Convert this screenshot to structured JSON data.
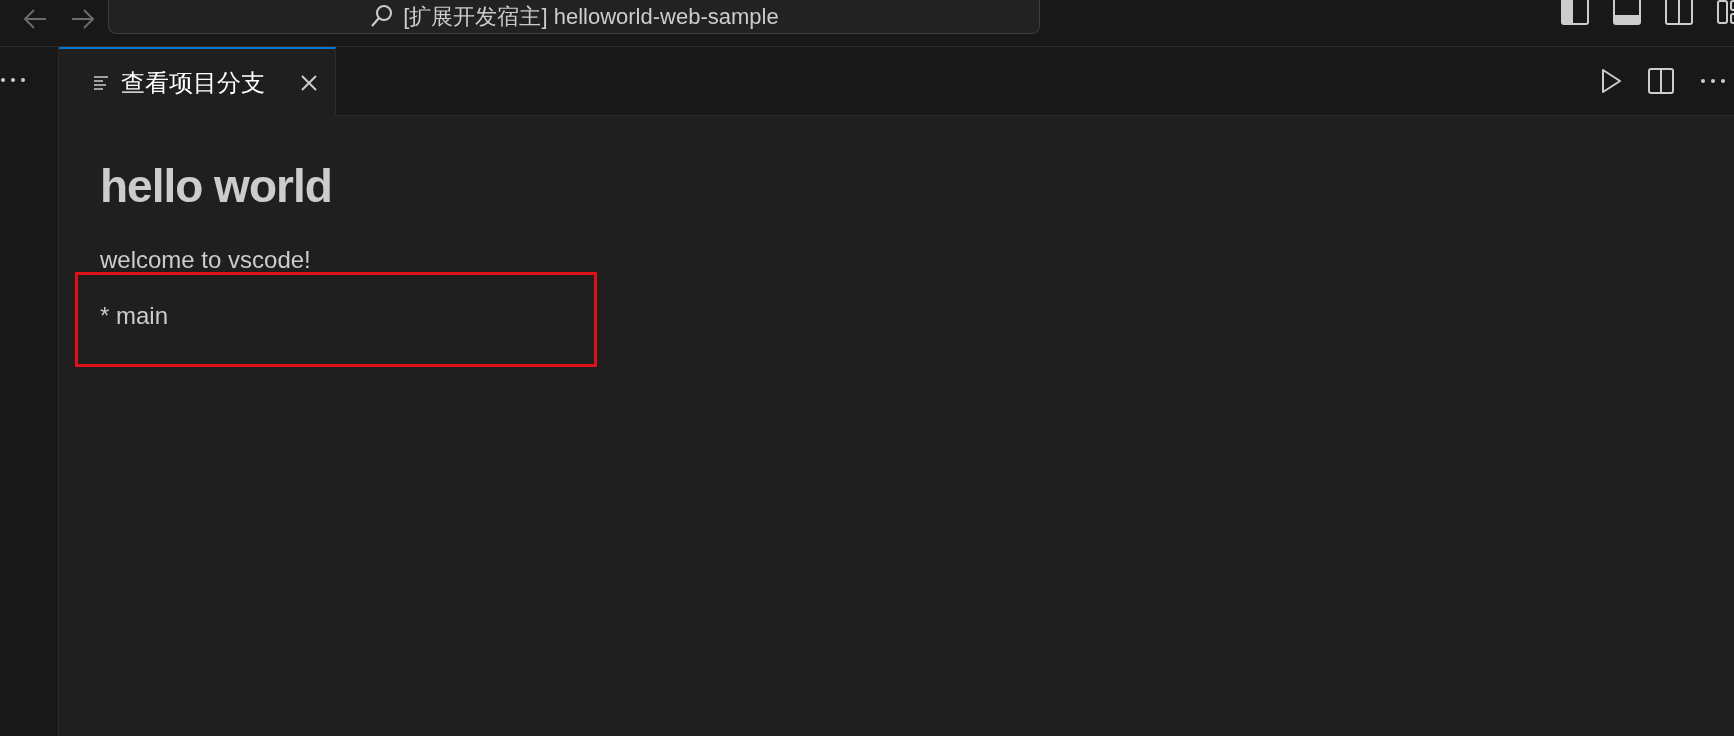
{
  "title_bar": {
    "command_center": "[扩展开发宿主] helloworld-web-sample"
  },
  "tabs": [
    {
      "label": "查看项目分支",
      "selected": true
    }
  ],
  "content": {
    "heading": "hello world",
    "paragraphs": [
      {
        "text": "welcome to vscode!"
      },
      {
        "text": "* main",
        "highlighted": true
      }
    ]
  }
}
